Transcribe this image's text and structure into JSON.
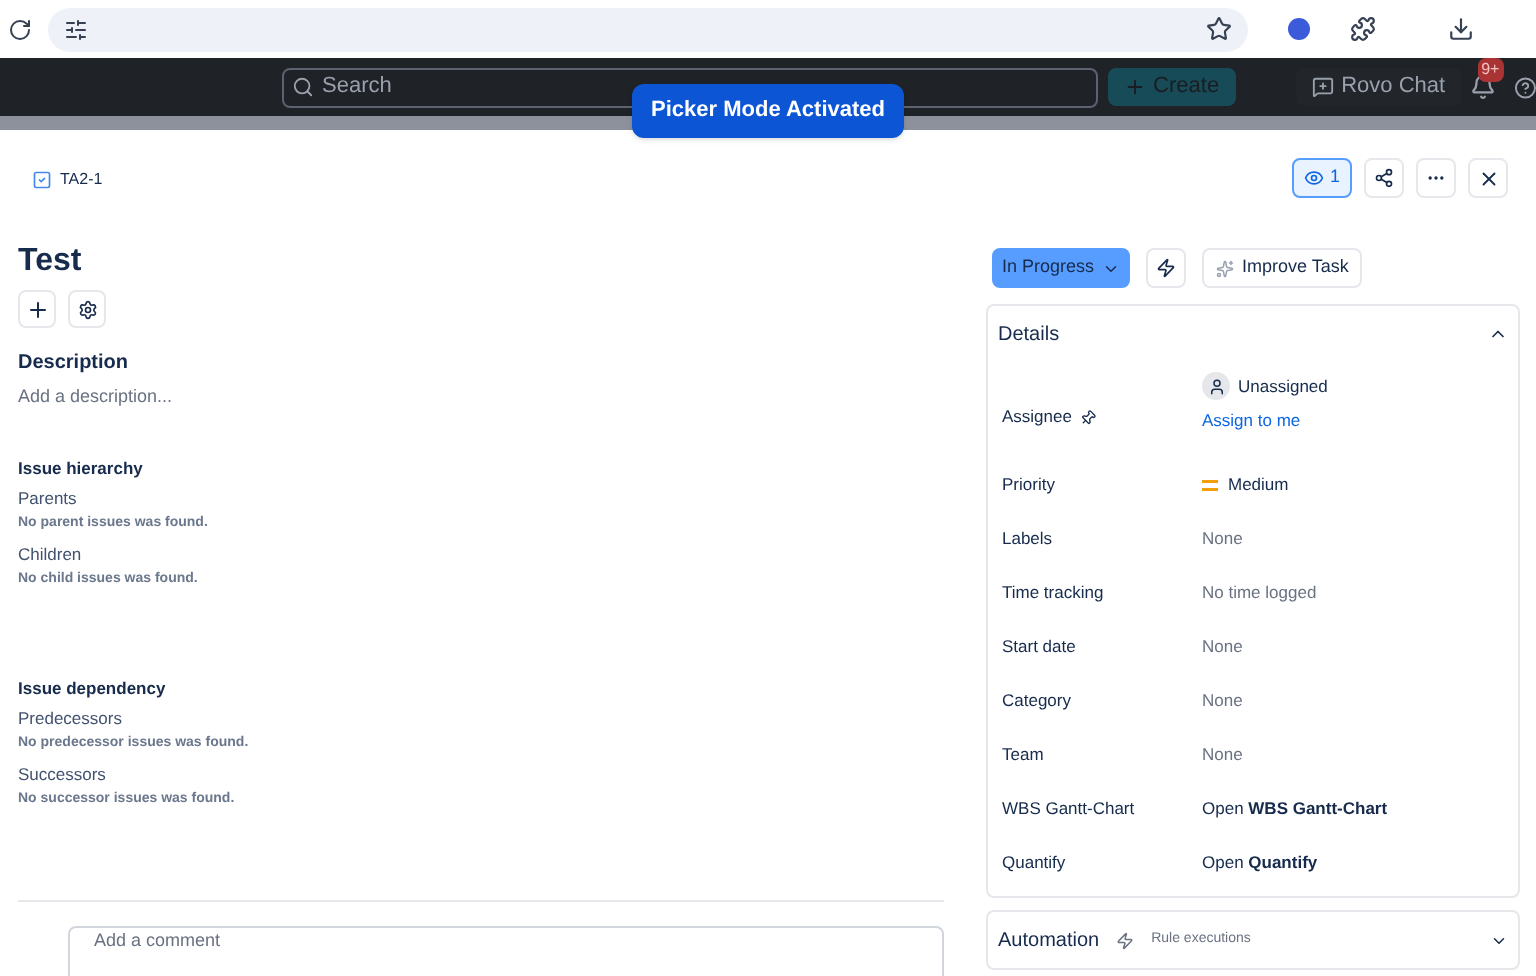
{
  "topbar": {
    "search": {
      "placeholder": "Search"
    },
    "create": "Create",
    "rovo": "Rovo Chat",
    "notifications": "9+"
  },
  "toast": "Picker Mode Activated",
  "issue": {
    "key": "TA2-1",
    "watchers": "1",
    "title": "Test",
    "description": {
      "heading": "Description",
      "placeholder": "Add a description..."
    }
  },
  "sections": [
    {
      "heading": "Issue hierarchy",
      "groups": [
        {
          "label": "Parents",
          "empty": "No parent issues was found."
        },
        {
          "label": "Children",
          "empty": "No child issues was found."
        }
      ]
    },
    {
      "heading": "Issue dependency",
      "groups": [
        {
          "label": "Predecessors",
          "empty": "No predecessor issues was found."
        },
        {
          "label": "Successors",
          "empty": "No successor issues was found."
        }
      ]
    }
  ],
  "comment": {
    "placeholder": "Add a comment"
  },
  "status": "In Progress",
  "improve": "Improve Task",
  "details": {
    "title": "Details",
    "expanded": true,
    "fields": [
      {
        "kind": "assignee",
        "label": "Assignee",
        "value": "Unassigned",
        "action": "Assign to me"
      },
      {
        "kind": "priority",
        "label": "Priority",
        "value": "Medium"
      },
      {
        "kind": "empty",
        "label": "Labels",
        "value": "None"
      },
      {
        "kind": "empty",
        "label": "Time tracking",
        "value": "No time logged"
      },
      {
        "kind": "empty",
        "label": "Start date",
        "value": "None"
      },
      {
        "kind": "empty",
        "label": "Category",
        "value": "None"
      },
      {
        "kind": "empty",
        "label": "Team",
        "value": "None"
      },
      {
        "kind": "link",
        "label": "WBS Gantt-Chart",
        "value": "Open **WBS Gantt-Chart**"
      },
      {
        "kind": "link",
        "label": "Quantify",
        "value": "Open **Quantify**"
      }
    ]
  },
  "automation": {
    "title": "Automation",
    "subtitle": "Rule executions",
    "expanded": false
  }
}
